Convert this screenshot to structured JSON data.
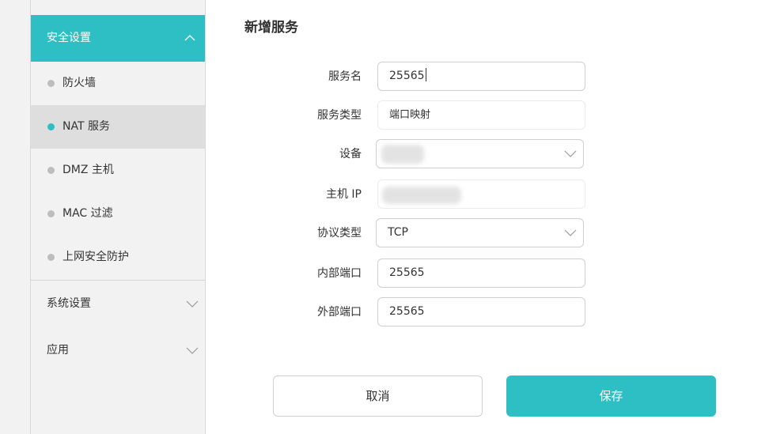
{
  "colors": {
    "accent": "#2ebfc4",
    "sidebar_bg": "#f2f2f2",
    "active_item_bg": "#dedede"
  },
  "sidebar": {
    "section": {
      "label": "安全设置",
      "icon": "chevron-up-icon"
    },
    "items": [
      {
        "label": "防火墙",
        "active": false
      },
      {
        "label": "NAT 服务",
        "active": true
      },
      {
        "label": "DMZ 主机",
        "active": false
      },
      {
        "label": "MAC 过滤",
        "active": false
      },
      {
        "label": "上网安全防护",
        "active": false
      }
    ],
    "groups": [
      {
        "label": "系统设置",
        "icon": "chevron-down-icon"
      },
      {
        "label": "应用",
        "icon": "chevron-down-icon"
      }
    ]
  },
  "form": {
    "title": "新增服务",
    "fields": {
      "service_name": {
        "label": "服务名",
        "value": "25565"
      },
      "service_type": {
        "label": "服务类型",
        "value": "端口映射"
      },
      "device": {
        "label": "设备",
        "value": ""
      },
      "host_ip": {
        "label": "主机 IP",
        "value": ""
      },
      "protocol": {
        "label": "协议类型",
        "value": "TCP"
      },
      "internal_port": {
        "label": "内部端口",
        "value": "25565"
      },
      "external_port": {
        "label": "外部端口",
        "value": "25565"
      }
    }
  },
  "buttons": {
    "cancel": "取消",
    "save": "保存"
  }
}
